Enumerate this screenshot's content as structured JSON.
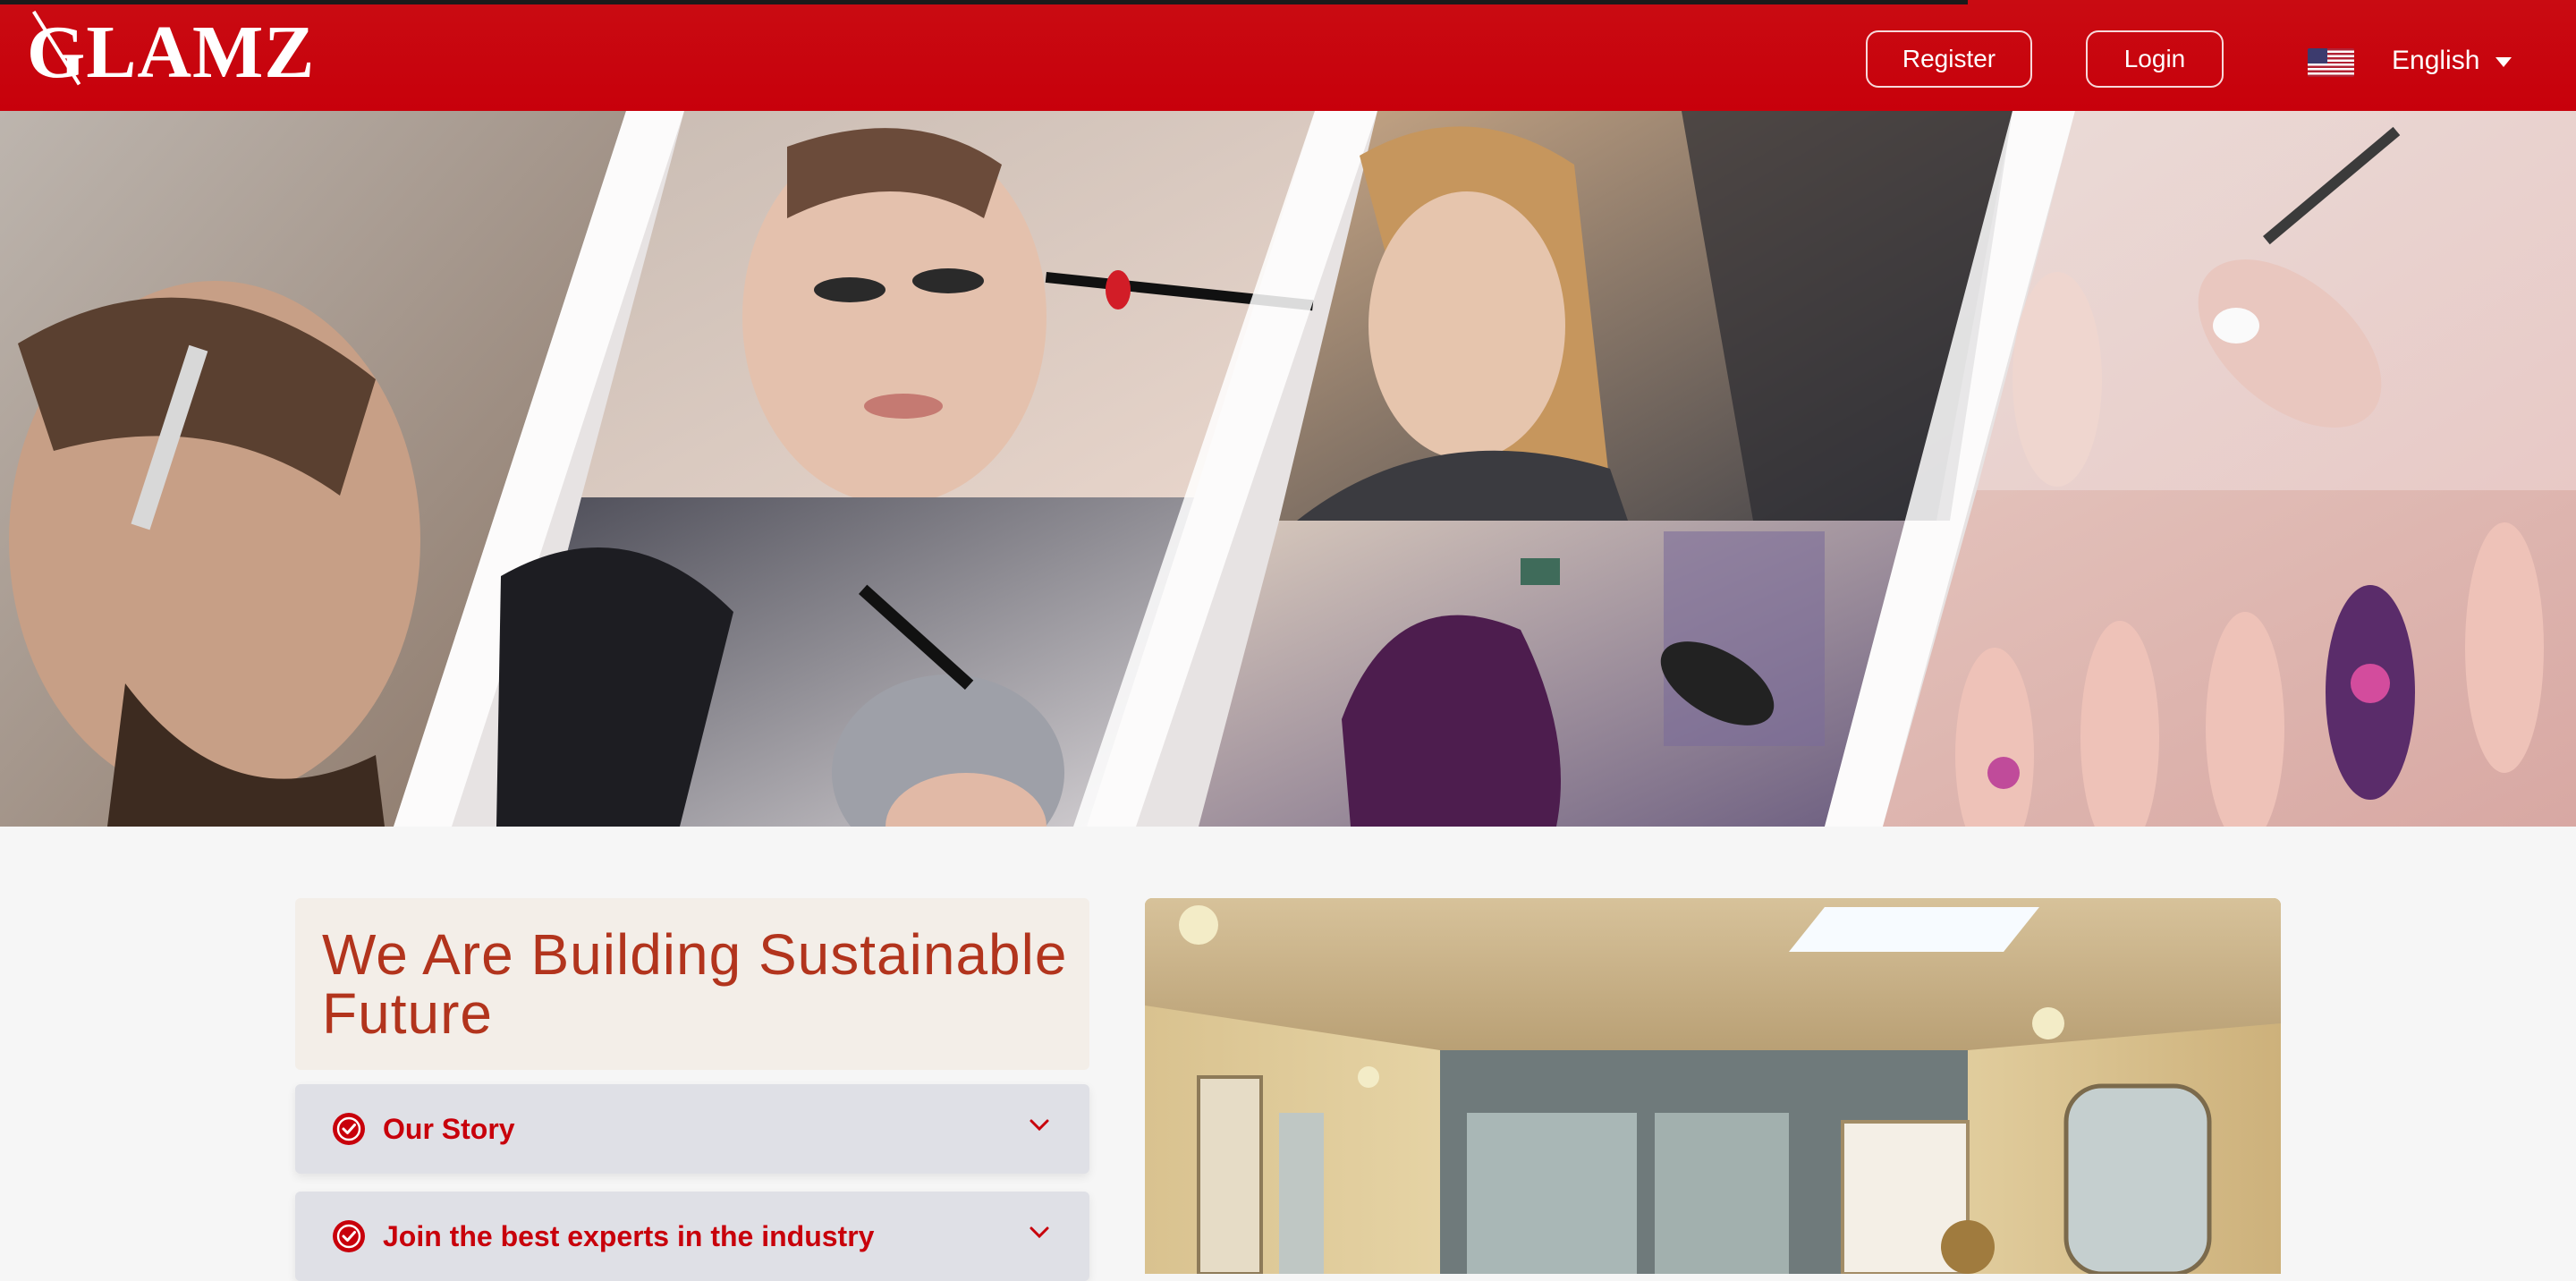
{
  "header": {
    "logo_text": "GLAMZ",
    "register_label": "Register",
    "login_label": "Login",
    "language": "English",
    "flag_icon": "us-flag-icon",
    "caret_icon": "caret-down-icon",
    "bg_color": "#c8000b"
  },
  "hero": {
    "panels": [
      "man-hair-styling-photo",
      "eyeliner-makeup-photo",
      "hair-coloring-photo",
      "blonde-hair-styling-photo",
      "purple-hair-blowdry-photo",
      "nail-art-brush-photo",
      "painted-nails-photo"
    ]
  },
  "about": {
    "heading": "We Are Building Sustainable Future",
    "accordion": [
      {
        "label": "Our Story",
        "icon": "check-circle-icon",
        "toggle_icon": "chevron-down-icon"
      },
      {
        "label": "Join the best experts in the industry",
        "icon": "check-circle-icon",
        "toggle_icon": "chevron-down-icon"
      }
    ],
    "accent_color": "#c8000b",
    "heading_color": "#b2341d"
  },
  "salon_photo": {
    "name": "salon-interior-photo"
  }
}
